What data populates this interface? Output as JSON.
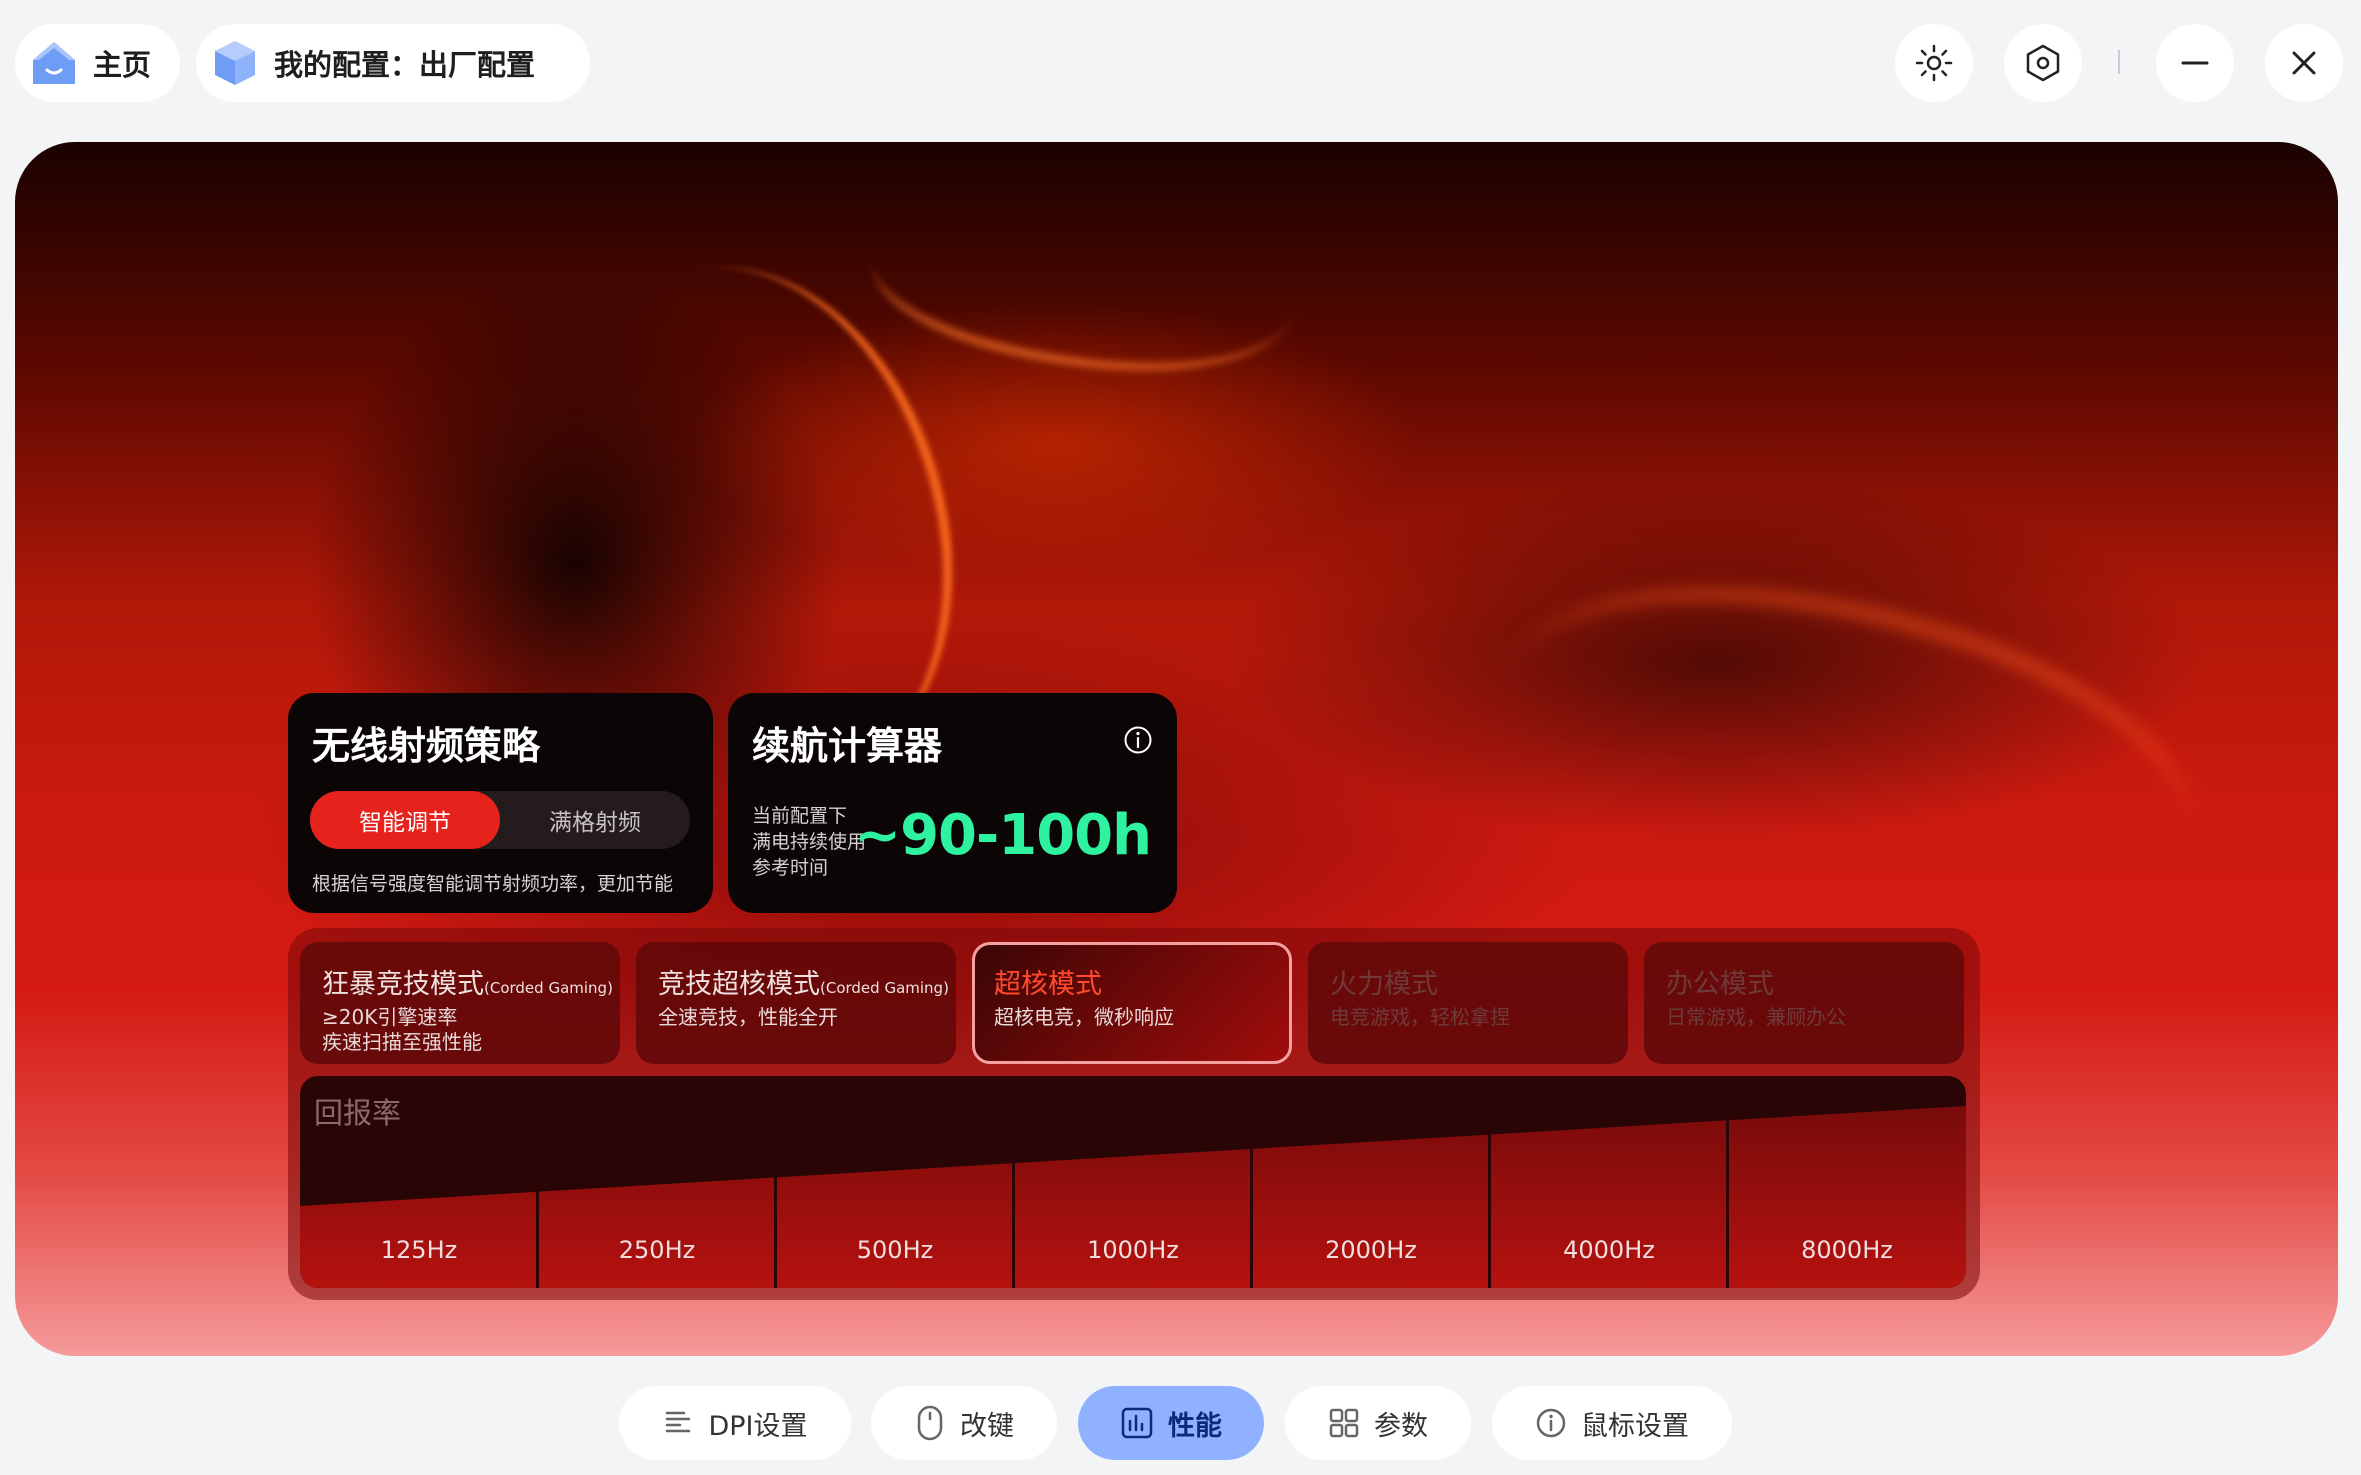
{
  "top_bar": {
    "home_label": "主页",
    "config_label": "我的配置：出厂配置",
    "icons": [
      "house-icon",
      "cube-icon",
      "sun-icon",
      "hexagon-settings-icon",
      "minimize-icon",
      "close-icon"
    ]
  },
  "rf_card": {
    "title": "无线射频策略",
    "options": [
      "智能调节",
      "满格射频"
    ],
    "selected": "智能调节",
    "description": "根据信号强度智能调节射频功率，更加节能"
  },
  "battery_card": {
    "title": "续航计算器",
    "sub_lines": [
      "当前配置下",
      "满电持续使用",
      "参考时间"
    ],
    "value": "~90-100h"
  },
  "modes": [
    {
      "title": "狂暴竞技模式",
      "tag": "(Corded Gaming)",
      "lines": [
        "≥20K引擎速率",
        "疾速扫描至强性能"
      ],
      "state": "normal"
    },
    {
      "title": "竞技超核模式",
      "tag": "(Corded Gaming)",
      "lines": [
        "全速竞技，性能全开"
      ],
      "state": "normal"
    },
    {
      "title": "超核模式",
      "tag": "",
      "lines": [
        "超核电竞，微秒响应"
      ],
      "state": "active"
    },
    {
      "title": "火力模式",
      "tag": "",
      "lines": [
        "电竞游戏，轻松拿捏"
      ],
      "state": "dim"
    },
    {
      "title": "办公模式",
      "tag": "",
      "lines": [
        "日常游戏，兼顾办公"
      ],
      "state": "dim"
    }
  ],
  "polling_rate": {
    "label": "回报率",
    "options": [
      "125Hz",
      "250Hz",
      "500Hz",
      "1000Hz",
      "2000Hz",
      "4000Hz",
      "8000Hz"
    ]
  },
  "bottom_nav": {
    "tabs": [
      {
        "label": "DPI设置",
        "icon": "dpi-bars-icon"
      },
      {
        "label": "改键",
        "icon": "mouse-icon"
      },
      {
        "label": "性能",
        "icon": "performance-chart-icon"
      },
      {
        "label": "参数",
        "icon": "grid-icon"
      },
      {
        "label": "鼠标设置",
        "icon": "info-circle-icon"
      }
    ],
    "active": "性能"
  },
  "colors": {
    "accent_red": "#e5221c",
    "battery_green": "#2ff2a0",
    "nav_active": "#8fb1ff",
    "active_mode_title": "#ff4a2e"
  }
}
